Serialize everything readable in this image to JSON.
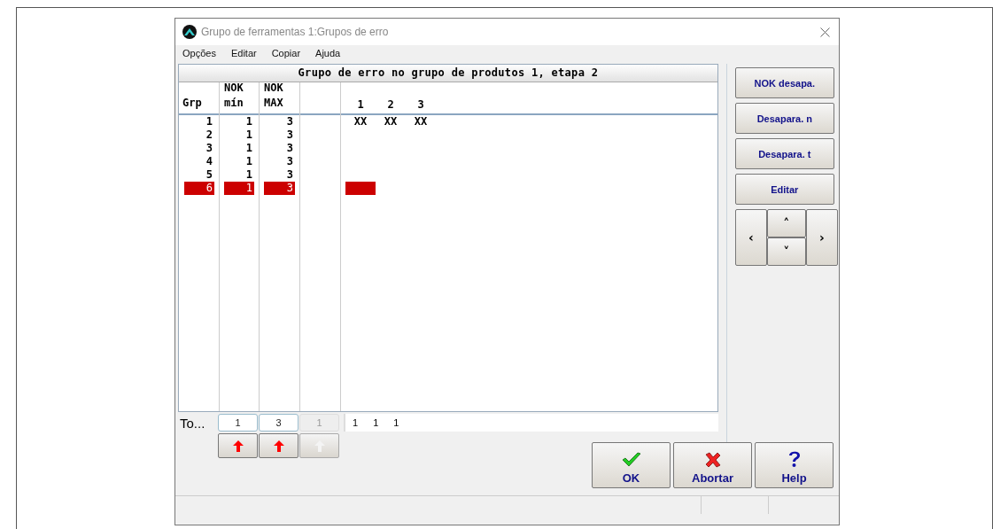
{
  "window": {
    "title": "Grupo de ferramentas 1:Grupos de erro"
  },
  "menu": [
    "Opções",
    "Editar",
    "Copiar",
    "Ajuda"
  ],
  "table": {
    "title": "Grupo de erro no grupo de produtos  1, etapa  2",
    "columns": [
      {
        "lines": [
          "Grp"
        ]
      },
      {
        "lines": [
          "NOK",
          "mín"
        ]
      },
      {
        "lines": [
          "NOK",
          "MAX"
        ]
      }
    ],
    "matrix_columns": [
      "1",
      "2",
      "3"
    ],
    "rows": [
      {
        "grp": "1",
        "min": "1",
        "max": "3",
        "cells": [
          "XX",
          "XX",
          "XX"
        ],
        "selected": false
      },
      {
        "grp": "2",
        "min": "1",
        "max": "3",
        "selected": false
      },
      {
        "grp": "3",
        "min": "1",
        "max": "3",
        "selected": false
      },
      {
        "grp": "4",
        "min": "1",
        "max": "3",
        "selected": false
      },
      {
        "grp": "5",
        "min": "1",
        "max": "3",
        "selected": false
      },
      {
        "grp": "6",
        "min": "1",
        "max": "3",
        "selected": true
      }
    ]
  },
  "totals": {
    "label": "To...",
    "fields": [
      {
        "value": "1",
        "disabled": false
      },
      {
        "value": "3",
        "disabled": false
      },
      {
        "value": "1",
        "disabled": true
      }
    ],
    "matrix": [
      "1",
      "1",
      "1"
    ]
  },
  "arrow_buttons": [
    {
      "disabled": false
    },
    {
      "disabled": false
    },
    {
      "disabled": true
    }
  ],
  "side_buttons": [
    "NOK desapa.",
    "Desapara. n",
    "Desapara. t",
    "Editar"
  ],
  "nav_buttons": [
    {
      "kind": "left",
      "label": "‹"
    },
    {
      "kind": "up",
      "label": "˄"
    },
    {
      "kind": "down",
      "label": "˅"
    },
    {
      "kind": "right",
      "label": "›"
    }
  ],
  "dialog_buttons": [
    {
      "kind": "ok",
      "label": "OK"
    },
    {
      "kind": "abort",
      "label": "Abortar"
    },
    {
      "kind": "help",
      "label": "Help"
    }
  ]
}
